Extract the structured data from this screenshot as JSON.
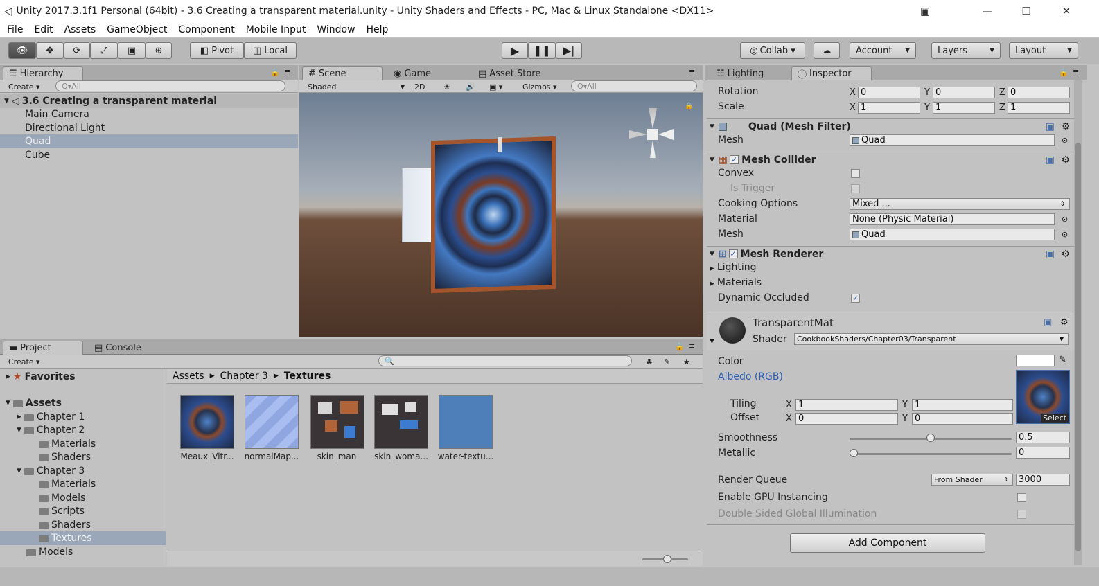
{
  "window": {
    "title": "Unity 2017.3.1f1 Personal (64bit) - 3.6 Creating a transparent material.unity - Unity Shaders and Effects - PC, Mac & Linux Standalone <DX11>",
    "controls": {
      "minimize": "—",
      "maximize": "☐",
      "close": "✕"
    }
  },
  "menu": [
    "File",
    "Edit",
    "Assets",
    "GameObject",
    "Component",
    "Mobile Input",
    "Window",
    "Help"
  ],
  "toolbar": {
    "pivot": "Pivot",
    "local": "Local",
    "collab": "Collab ▾",
    "account": "Account",
    "layers": "Layers",
    "layout": "Layout"
  },
  "hierarchy": {
    "tab": "Hierarchy",
    "create": "Create ▾",
    "search_placeholder": "Q▾All",
    "scene_name": "3.6 Creating a transparent material",
    "items": [
      "Main Camera",
      "Directional Light",
      "Quad",
      "Cube"
    ],
    "selected": "Quad"
  },
  "scene": {
    "tabs": [
      "Scene",
      "Game",
      "Asset Store"
    ],
    "shaded": "Shaded",
    "mode_2d": "2D",
    "gizmos": "Gizmos ▾",
    "search_placeholder": "Q▾All"
  },
  "project": {
    "tabs": [
      "Project",
      "Console"
    ],
    "create": "Create ▾",
    "breadcrumb": [
      "Assets",
      "Chapter 3",
      "Textures"
    ],
    "tree": [
      {
        "label": "Favorites",
        "indent": 0,
        "bold": true
      },
      {
        "label": "Assets",
        "indent": 0,
        "bold": true
      },
      {
        "label": "Chapter 1",
        "indent": 1
      },
      {
        "label": "Chapter 2",
        "indent": 1
      },
      {
        "label": "Materials",
        "indent": 2
      },
      {
        "label": "Shaders",
        "indent": 2
      },
      {
        "label": "Chapter 3",
        "indent": 1
      },
      {
        "label": "Materials",
        "indent": 2
      },
      {
        "label": "Models",
        "indent": 2
      },
      {
        "label": "Scripts",
        "indent": 2
      },
      {
        "label": "Shaders",
        "indent": 2
      },
      {
        "label": "Textures",
        "indent": 2
      },
      {
        "label": "Models",
        "indent": 1
      }
    ],
    "assets": [
      "Meaux_Vitr...",
      "normalMap...",
      "skin_man",
      "skin_woma...",
      "water-textu..."
    ]
  },
  "inspector": {
    "tabs": [
      "Lighting",
      "Inspector"
    ],
    "transform": {
      "rotation_label": "Rotation",
      "rotation": [
        "0",
        "0",
        "0"
      ],
      "scale_label": "Scale",
      "scale": [
        "1",
        "1",
        "1"
      ],
      "axes": [
        "X",
        "Y",
        "Z"
      ]
    },
    "mesh_filter": {
      "title": "Quad (Mesh Filter)",
      "mesh_label": "Mesh",
      "mesh_value": "Quad"
    },
    "mesh_collider": {
      "title": "Mesh Collider",
      "convex": "Convex",
      "is_trigger": "Is Trigger",
      "cooking_label": "Cooking Options",
      "cooking_value": "Mixed ...",
      "material_label": "Material",
      "material_value": "None (Physic Material)",
      "mesh_label": "Mesh",
      "mesh_value": "Quad"
    },
    "mesh_renderer": {
      "title": "Mesh Renderer",
      "lighting": "Lighting",
      "materials": "Materials",
      "dynamic_occluded": "Dynamic Occluded"
    },
    "material": {
      "name": "TransparentMat",
      "shader_label": "Shader",
      "shader_value": "CookbookShaders/Chapter03/Transparent",
      "color_label": "Color",
      "albedo_label": "Albedo (RGB)",
      "select": "Select",
      "tiling_label": "Tiling",
      "tiling": [
        "1",
        "1"
      ],
      "offset_label": "Offset",
      "offset": [
        "0",
        "0"
      ],
      "smoothness_label": "Smoothness",
      "smoothness_value": "0.5",
      "smoothness_level": 0.5,
      "metallic_label": "Metallic",
      "metallic_value": "0",
      "metallic_level": 0,
      "render_queue_label": "Render Queue",
      "render_queue_mode": "From Shader",
      "render_queue_value": "3000",
      "gpu_instancing": "Enable GPU Instancing",
      "double_sided": "Double Sided Global Illumination"
    },
    "add_component": "Add Component"
  },
  "colors": {
    "accent_blue": "#2b5fb0",
    "selection": "#9aa7b9",
    "panel": "#c2c2c2"
  }
}
